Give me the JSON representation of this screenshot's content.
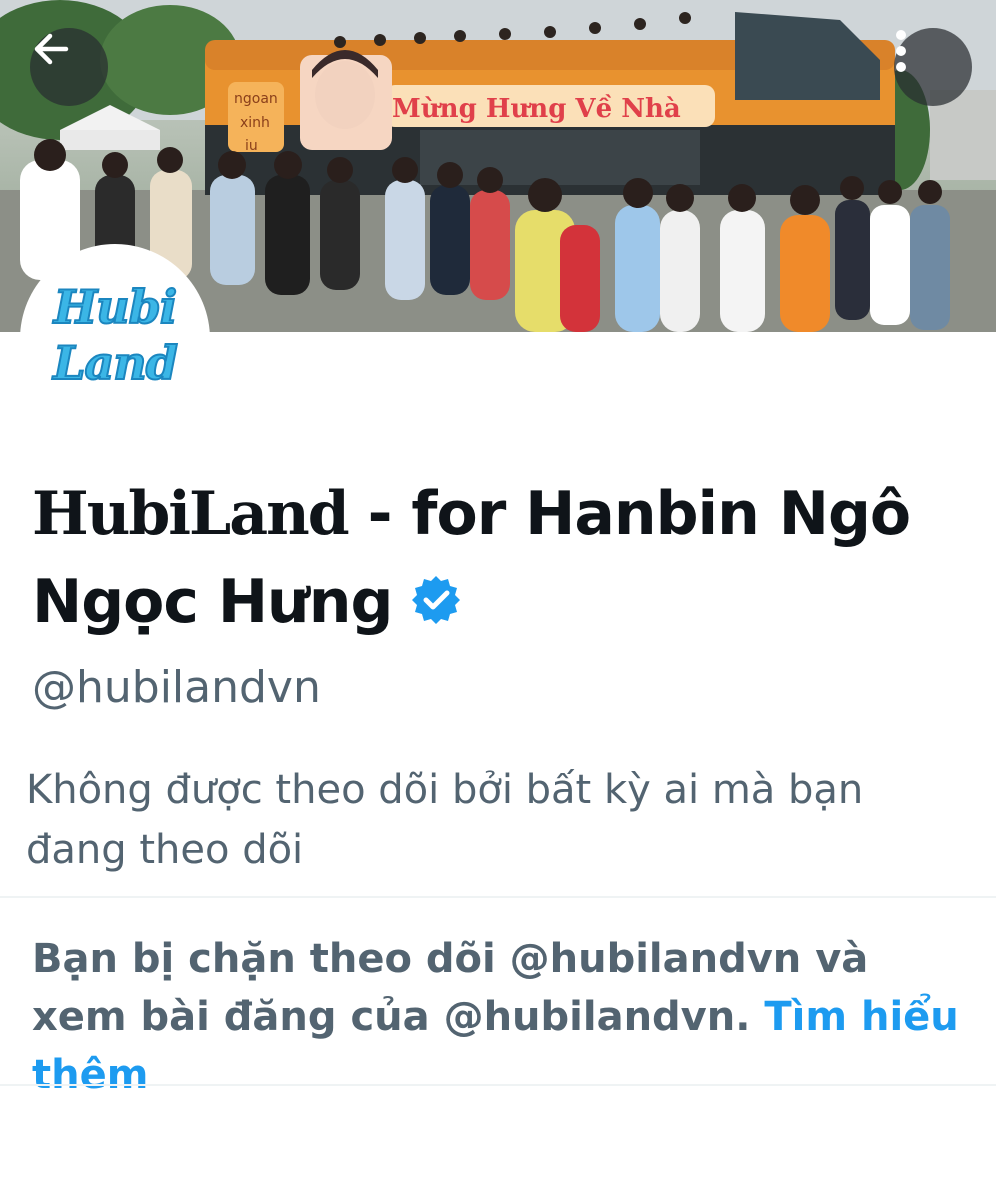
{
  "banner": {
    "bus_sign": "Mừng Hưng Về Nhà",
    "bus_side_words": [
      "ngoan",
      "xinh",
      "iu"
    ]
  },
  "header": {
    "back_icon": "arrow-left-icon",
    "more_icon": "more-vertical-icon"
  },
  "avatar": {
    "logo_line1": "Hubi",
    "logo_line2": "Land"
  },
  "profile": {
    "name_brand": "HubiLand",
    "name_rest": " - for Hanbin Ngô Ngọc Hưng",
    "verified_icon": "verified-badge-icon",
    "handle": "@hubilandvn",
    "followers_note": "Không được theo dõi bởi bất kỳ ai mà bạn đang theo dõi"
  },
  "block": {
    "message": "Bạn bị chặn theo dõi @hubilandvn và xem bài đăng của @hubilandvn.",
    "link_label": "Tìm hiểu thêm"
  },
  "colors": {
    "accent": "#1d9bf0",
    "text_primary": "#0f1419",
    "text_secondary": "#536471",
    "bus_orange": "#e8922f"
  }
}
